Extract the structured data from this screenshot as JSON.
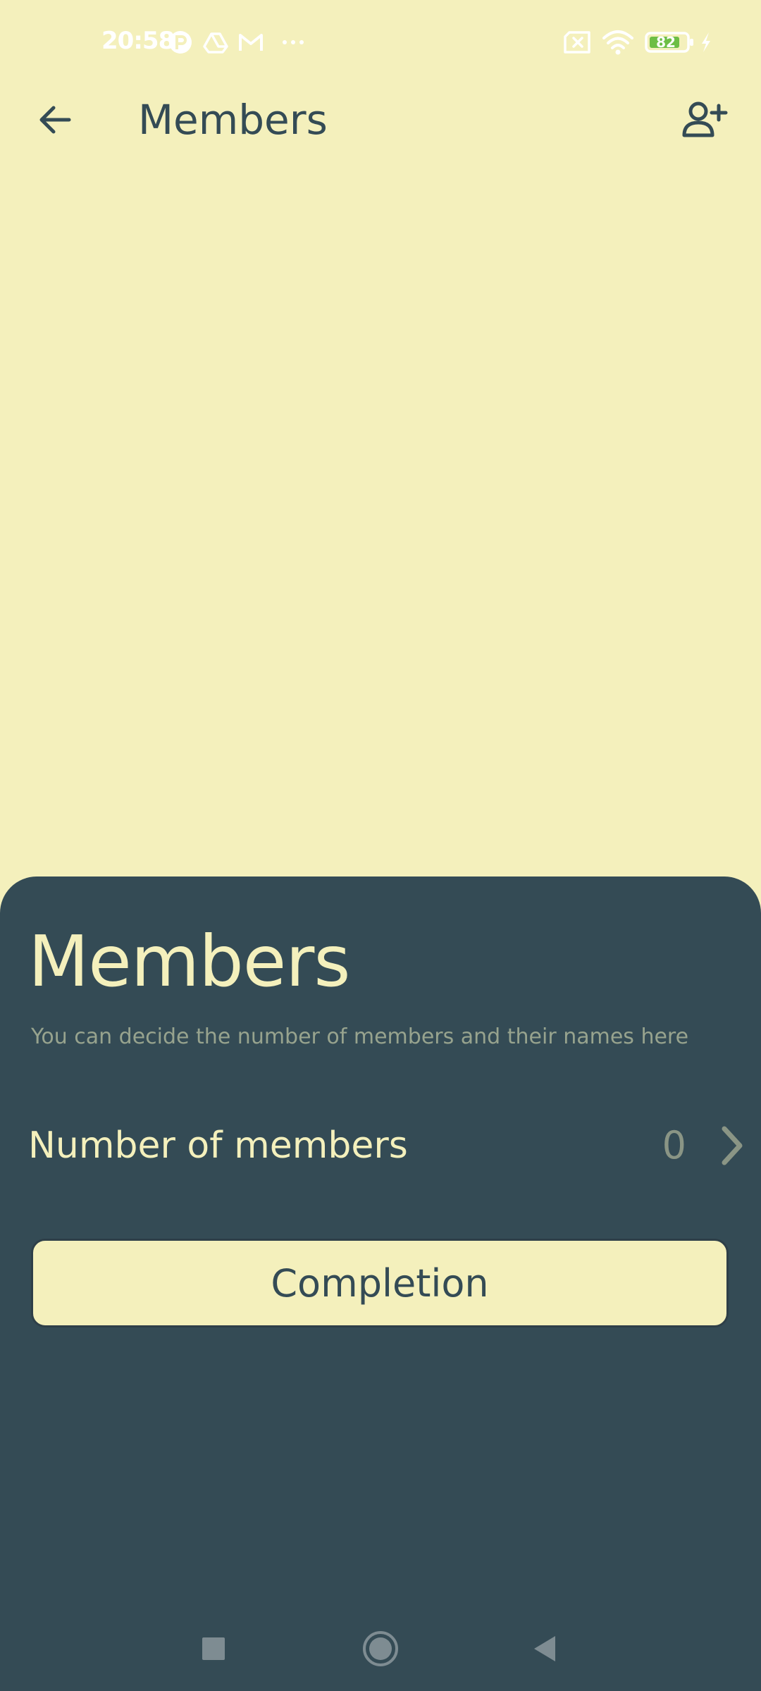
{
  "status_bar": {
    "time": "20:58",
    "battery_level": "82",
    "icons": [
      "app-notification-icon",
      "drive-icon",
      "gmail-icon",
      "more-dots-icon",
      "sim-x-icon",
      "wifi-icon",
      "battery-icon",
      "charging-bolt-icon"
    ]
  },
  "app_bar": {
    "title": "Members",
    "back_icon": "arrow-left-icon",
    "action_icon": "person-add-icon"
  },
  "sheet": {
    "title": "Members",
    "description": "You can decide the number of members and their names here",
    "members_row": {
      "label": "Number of members",
      "value": "0"
    },
    "completion_button": "Completion"
  },
  "nav_bar": {
    "icons": [
      "recents-square-icon",
      "home-circle-icon",
      "back-triangle-icon"
    ]
  },
  "colors": {
    "background": "#F4F0BC",
    "sheet": "#344B55",
    "accent_text": "#F4F0BC",
    "muted_text": "#97A38E"
  }
}
